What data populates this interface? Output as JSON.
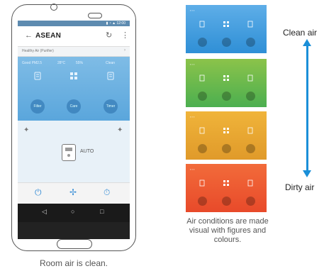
{
  "phone": {
    "app_title": "ASEAN",
    "device_label": "Healthy Air (Purifier)",
    "status": {
      "pm25": "Good PM2.5",
      "temp": "28°C",
      "humidity": "55%",
      "extra": "Clean"
    },
    "status_buttons": [
      "Filter",
      "Care",
      "Timer"
    ],
    "mode": "AUTO",
    "bottom_icons": [
      "power-icon",
      "fan-icon",
      "timer-icon"
    ],
    "nav_icons": [
      "back-nav-icon",
      "home-nav-icon",
      "recent-nav-icon"
    ]
  },
  "captions": {
    "room": "Room air is clean.",
    "air": "Air conditions are made visual with figures and colours."
  },
  "scale": {
    "clean_label": "Clean air",
    "dirty_label": "Dirty air"
  },
  "colors": {
    "clean": "#2f8fd6",
    "good": "#6bb94a",
    "moderate": "#e8a832",
    "dirty": "#ee5a32",
    "arrow": "#1a8fd8"
  }
}
